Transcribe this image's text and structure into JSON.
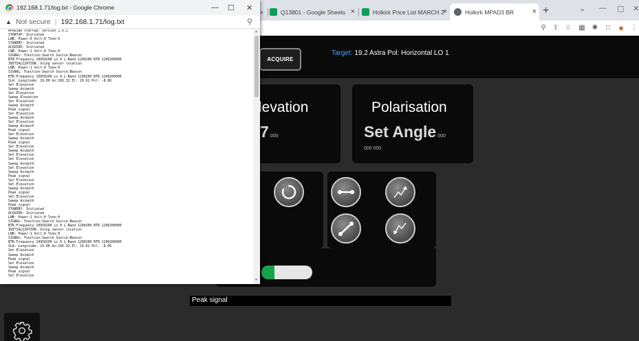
{
  "background_browser": {
    "tabs": [
      {
        "title": "Q13801 - Google Sheets",
        "close": "×",
        "favicon_color": "#0f9d58"
      },
      {
        "title": "Holkirk Price List MARCH 2",
        "close": "×",
        "favicon_color": "#0f9d58"
      },
      {
        "title": "Holkirk MPAD3 BR",
        "close": "×",
        "favicon_color": "#5f6368"
      }
    ],
    "left_tab_close": "×",
    "new_tab": "+",
    "window_controls": [
      "⌄",
      "—",
      "▢",
      "✕"
    ],
    "toolbar_icons": [
      "⚲",
      "⇪",
      "☆",
      "▦",
      "✱",
      "□",
      "●",
      "⋮"
    ]
  },
  "popup": {
    "title": "192.168.1.71/log.txt - Google Chrome",
    "controls": [
      "—",
      "☐",
      "✕"
    ],
    "security_label": "Not secure",
    "security_icon": "▲",
    "separator": "|",
    "url": "192.168.1.71/log.txt",
    "zoom_icon": "⚲",
    "log_lines": [
      "MPAD3BR startup: Version 1.0.2",
      "STARTUP: Initiated",
      "LNB: Power:0 Volt:0 Tone:0",
      "STANDBY: Initiated",
      "ACQUIRE: Initiated",
      "LNB: Power:1 Volt:0 Tone:0",
      "SIGNAL: Function:Search Source:Beacon",
      "BTR:Frequency 10950200 Lo 0 L-Band 1200200 BTR 1200200000",
      "INITIALIZATION: Using sensor location",
      "LNB: Power:1 Volt:0 Tone:0",
      "SIGNAL: Function:Search Source:Beacon",
      "BTR:Frequency 10950200 Lo 0 L-Band 1200200 BTR 1200200000",
      "SLA: Longitude: 19.00 Az:166.32 El: 29.62 Pol: -8.06",
      "Set Elevation",
      "Sweep Azimuth",
      "Set Elevation",
      "Sweep Elevation",
      "Set Elevation",
      "Sweep Azimuth",
      "Peak signal",
      "Set Elevation",
      "Sweep Azimuth",
      "Set Elevation",
      "Sweep Azimuth",
      "Peak signal",
      "Set Elevation",
      "Sweep Azimuth",
      "Peak signal",
      "Set Elevation",
      "Sweep Azimuth",
      "Set Elevation",
      "Set Elevation",
      "Sweep Azimuth",
      "Set Elevation",
      "Sweep Azimuth",
      "Peak signal",
      "Set Elevation",
      "Set Elevation",
      "Sweep Azimuth",
      "Peak signal",
      "Set Elevation",
      "Sweep Azimuth",
      "Peak signal",
      "STANDBY: Initiated",
      "ACQUIRE: Initiated",
      "LNB: Power:1 Volt:0 Tone:0",
      "SIGNAL: Function:Search Source:Beacon",
      "BTR:Frequency 10950200 Lo 0 L-Band 1200200 BTR 1200200000",
      "INITIALIZATION: Using sensor location",
      "LNB: Power:1 Volt:0 Tone:0",
      "SIGNAL: Function:Search Source:Beacon",
      "BTR:Frequency 10950200 Lo 0 L-Band 1200200 BTR 1200200000",
      "SLA: Longitude: 19.00 Az:166.32 El: 29.62 Pol: -8.06",
      "Set Elevation",
      "Sweep Azimuth",
      "Peak signal",
      "Set Elevation",
      "Sweep Azimuth",
      "Peak signal",
      "Set Elevation"
    ]
  },
  "app": {
    "acquire_label": "ACQUIRE",
    "target_label": "Target:",
    "target_value": " 19.2 Astra Pol: Horizontal LO 1",
    "elevation": {
      "title": "Elevation",
      "value": "7",
      "unit": "000"
    },
    "polarisation": {
      "title": "Polarisation",
      "value": "Set Angle",
      "unit": "000",
      "sub": "000 000"
    },
    "signal": {
      "level_fraction": 0.25,
      "fill_color": "#17a34a"
    },
    "status_text": "Peak signal",
    "control_buttons": [
      "rotate-button",
      "connect-button",
      "align-button",
      "peak-up-button",
      "peak-down-button"
    ]
  }
}
